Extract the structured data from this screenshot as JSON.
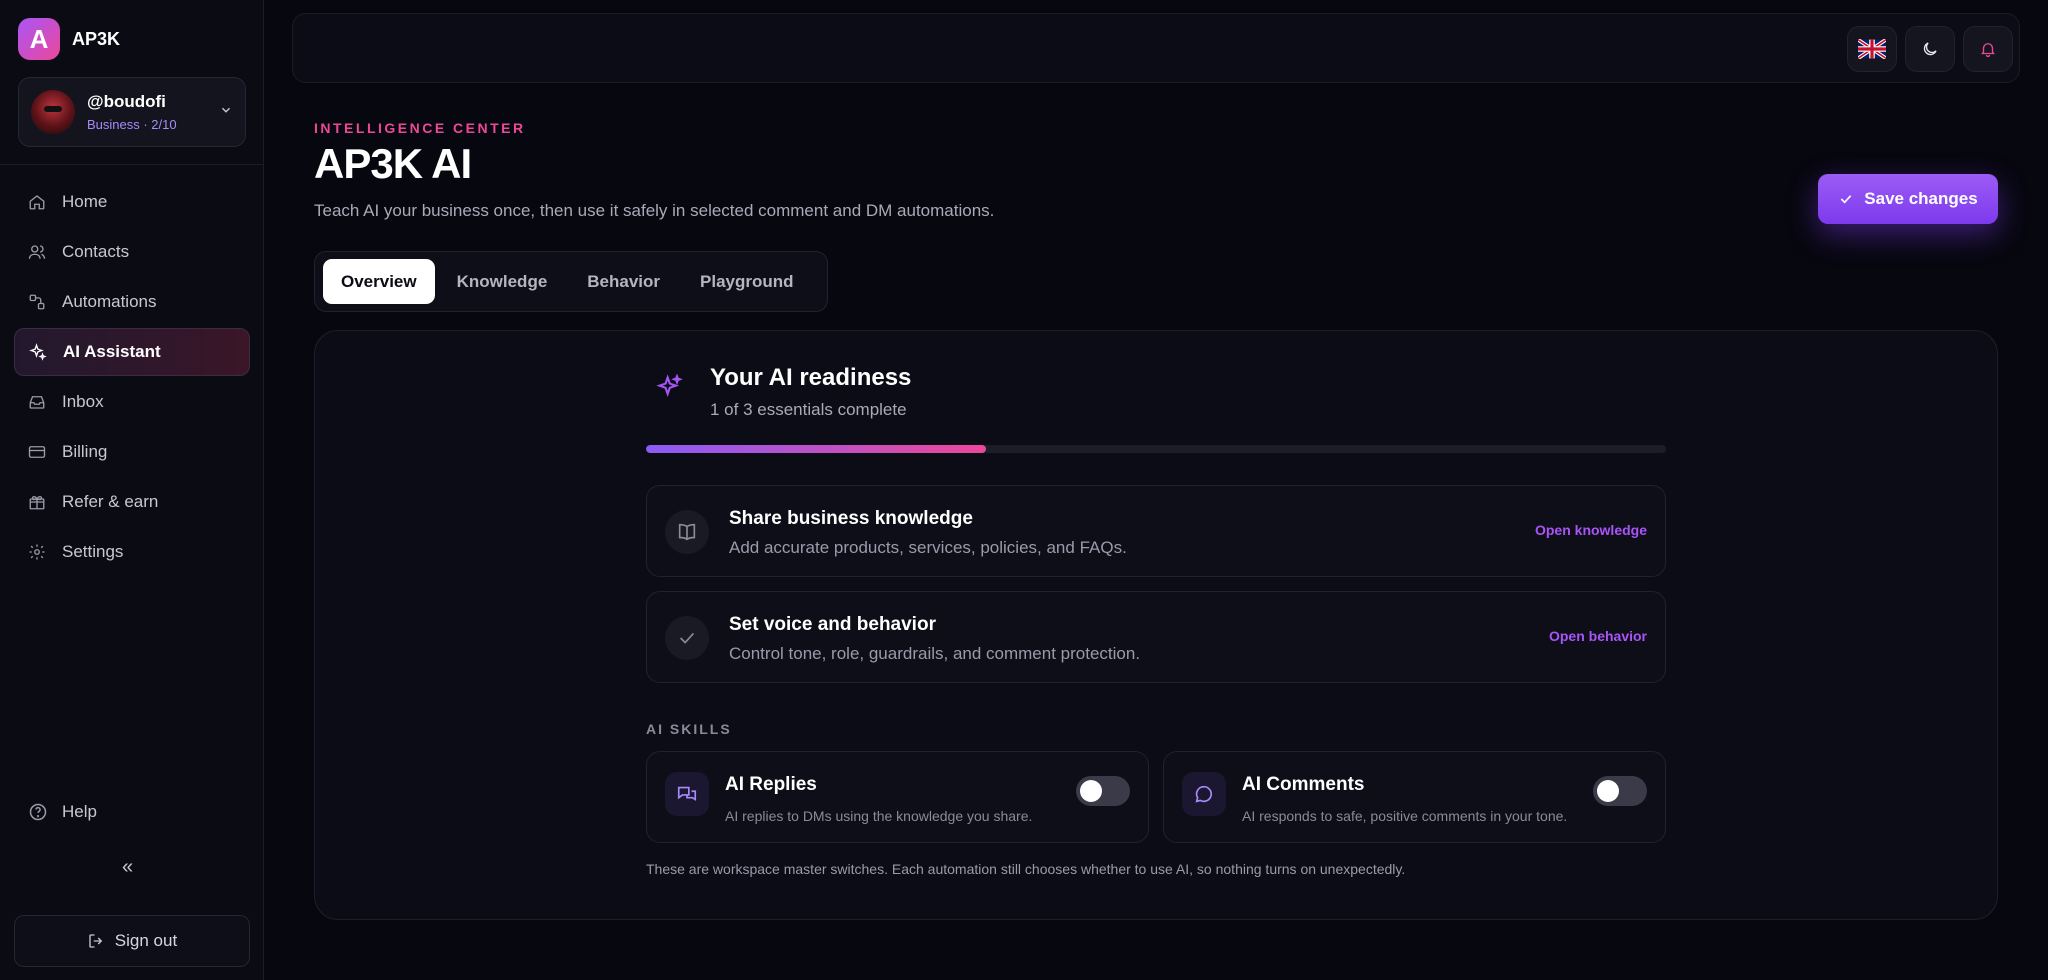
{
  "brand": {
    "logo_letter": "A",
    "name": "AP3K"
  },
  "account": {
    "handle": "@boudofi",
    "plan": "Business · 2/10"
  },
  "nav": [
    {
      "label": "Home",
      "icon": "home-icon"
    },
    {
      "label": "Contacts",
      "icon": "users-icon"
    },
    {
      "label": "Automations",
      "icon": "workflow-icon"
    },
    {
      "label": "AI Assistant",
      "icon": "sparkles-icon",
      "active": true
    },
    {
      "label": "Inbox",
      "icon": "inbox-icon"
    },
    {
      "label": "Billing",
      "icon": "credit-card-icon"
    },
    {
      "label": "Refer & earn",
      "icon": "gift-icon"
    },
    {
      "label": "Settings",
      "icon": "gear-icon"
    }
  ],
  "help_label": "Help",
  "collapse_glyph": "«",
  "signout_label": "Sign out",
  "header": {
    "eyebrow": "INTELLIGENCE CENTER",
    "title": "AP3K AI",
    "subtitle": "Teach AI your business once, then use it safely in selected comment and DM automations.",
    "save_label": "Save changes"
  },
  "tabs": [
    {
      "label": "Overview",
      "active": true
    },
    {
      "label": "Knowledge"
    },
    {
      "label": "Behavior"
    },
    {
      "label": "Playground"
    }
  ],
  "readiness": {
    "title": "Your AI readiness",
    "subtitle": "1 of 3 essentials complete",
    "progress_fraction": 0.333
  },
  "tasks": [
    {
      "title": "Share business knowledge",
      "desc": "Add accurate products, services, policies, and FAQs.",
      "link": "Open knowledge",
      "icon": "book-icon"
    },
    {
      "title": "Set voice and behavior",
      "desc": "Control tone, role, guardrails, and comment protection.",
      "link": "Open behavior",
      "icon": "check-icon"
    }
  ],
  "skills_label": "AI SKILLS",
  "skills": [
    {
      "title": "AI Replies",
      "desc": "AI replies to DMs using the knowledge you share.",
      "enabled": false,
      "icon": "chat-bubbles-icon"
    },
    {
      "title": "AI Comments",
      "desc": "AI responds to safe, positive comments in your tone.",
      "enabled": false,
      "icon": "comment-icon"
    }
  ],
  "footnote": "These are workspace master switches. Each automation still chooses whether to use AI, so nothing turns on unexpectedly.",
  "colors": {
    "accent": "#8b5cf6",
    "pink": "#ec4899",
    "background": "#07070f"
  }
}
